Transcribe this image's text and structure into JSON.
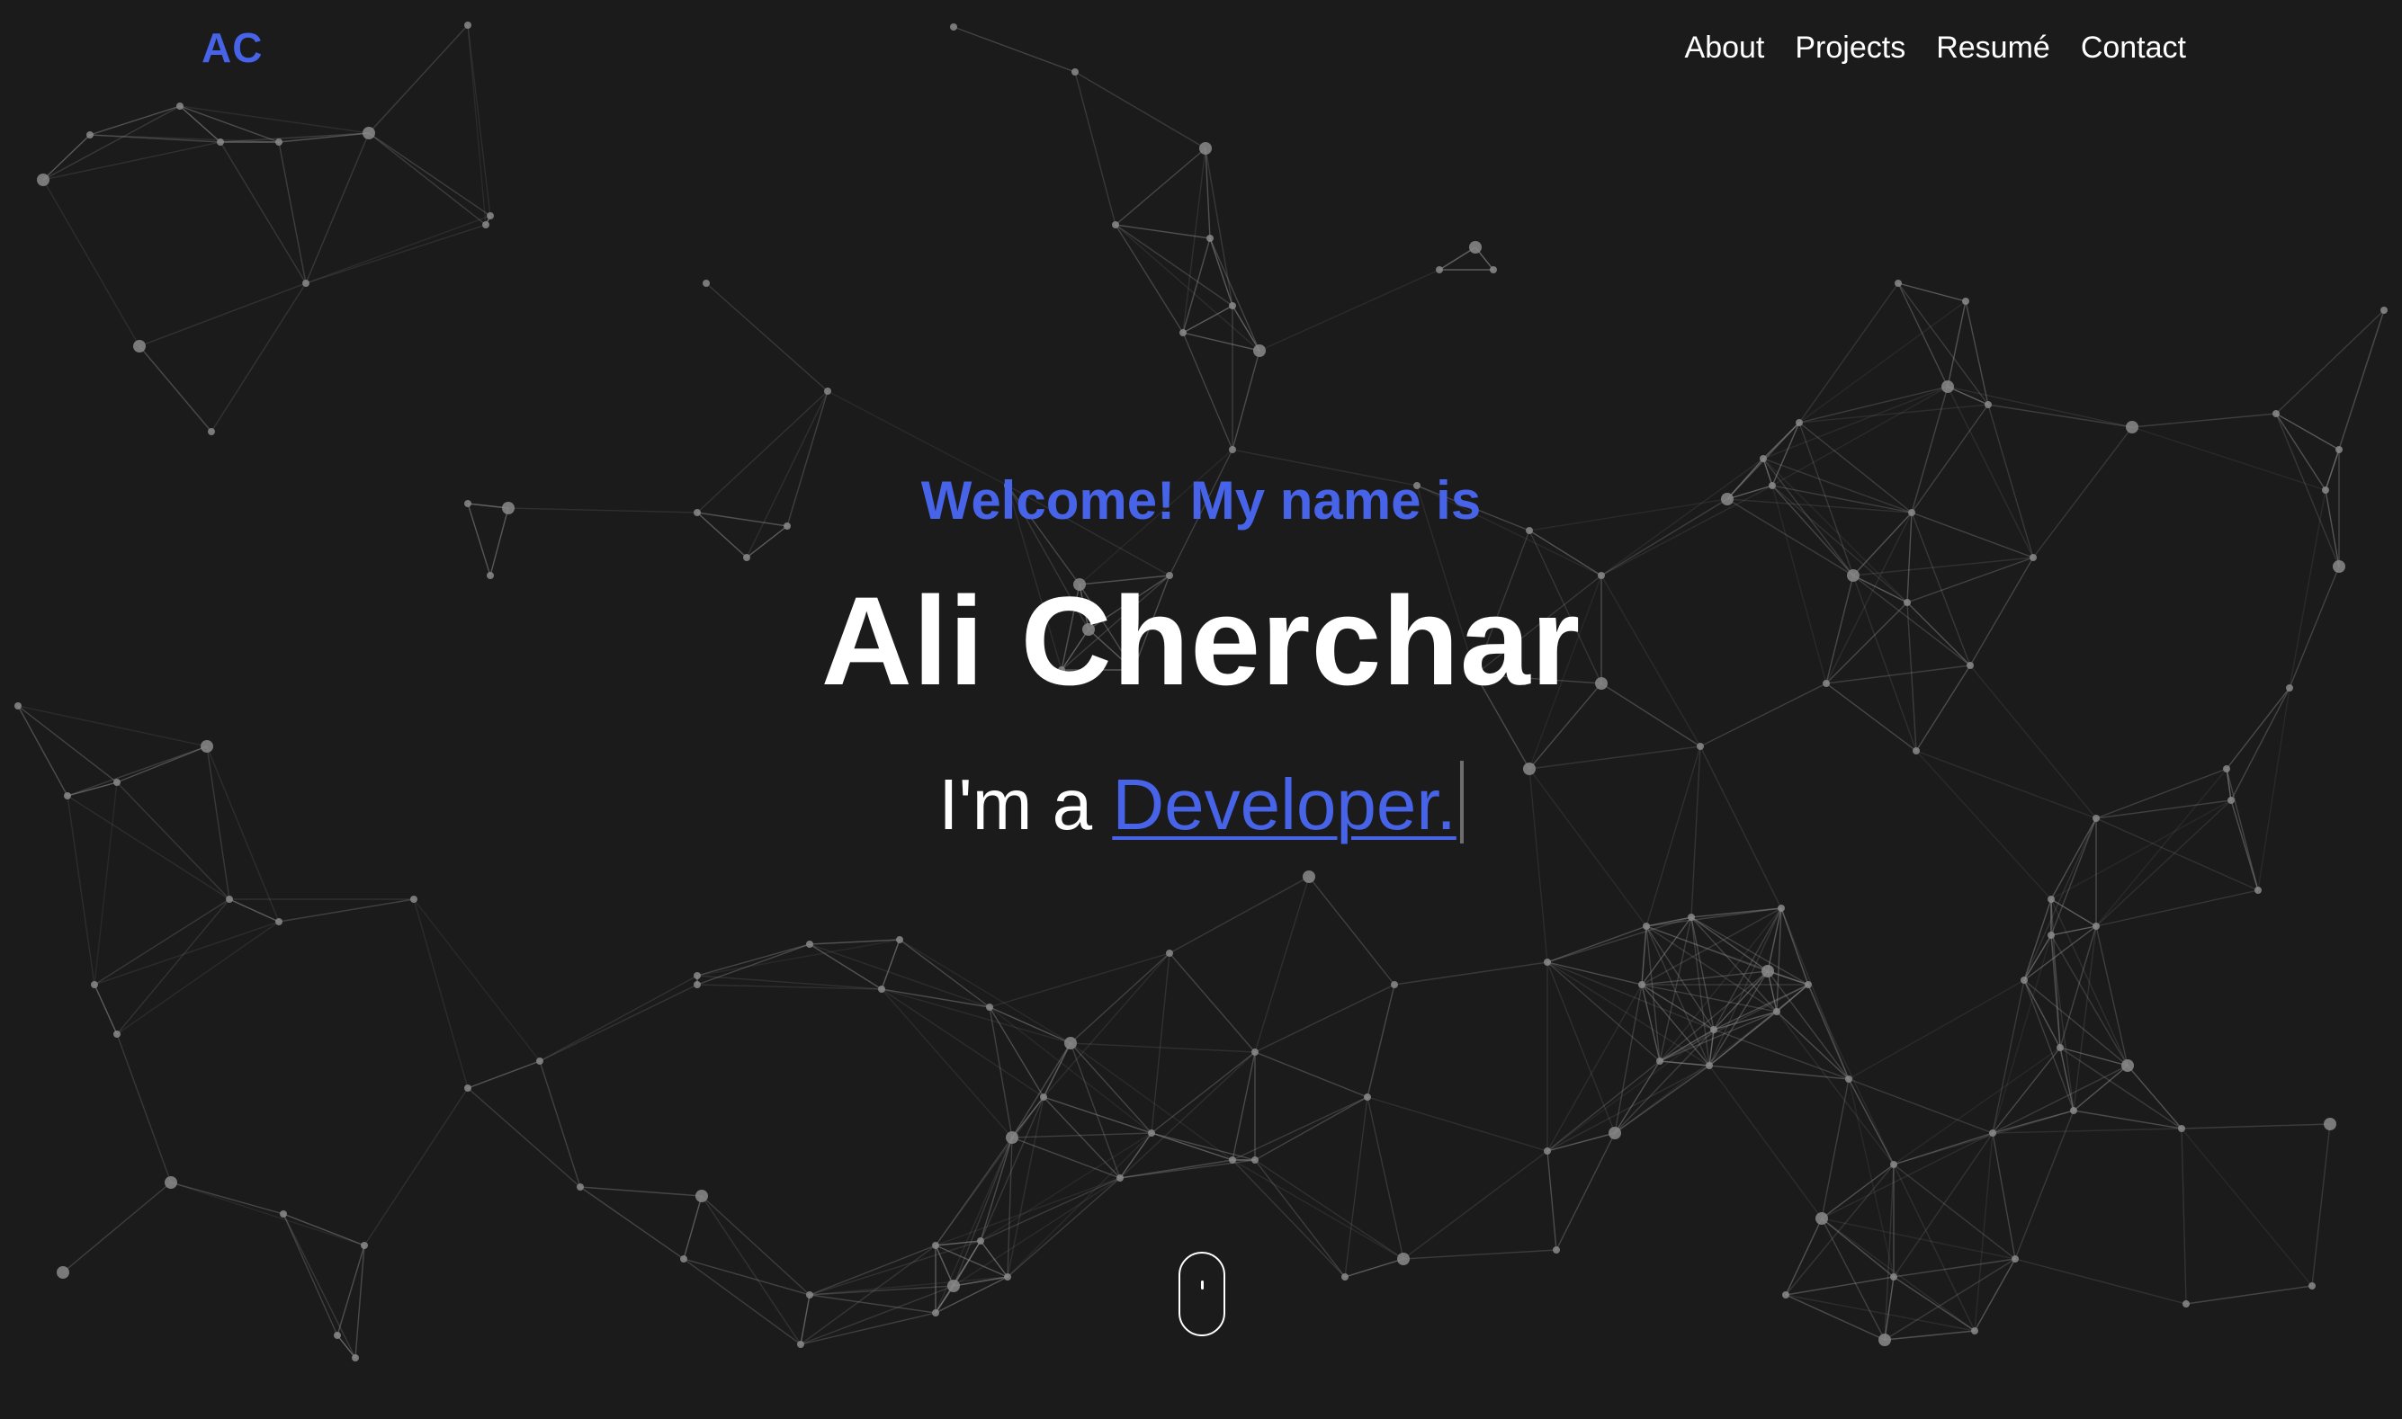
{
  "header": {
    "logo": "AC",
    "nav": [
      "About",
      "Projects",
      "Resumé",
      "Contact"
    ]
  },
  "hero": {
    "greeting": "Welcome! My name is",
    "name": "Ali Cherchar",
    "tagline_prefix": "I'm a",
    "role": "Developer."
  },
  "colors": {
    "background": "#1b1b1b",
    "accent": "#4763e8",
    "text": "#ffffff",
    "network": "#8a8a8a"
  },
  "icons": {
    "scroll_indicator": "mouse-scroll-icon"
  }
}
